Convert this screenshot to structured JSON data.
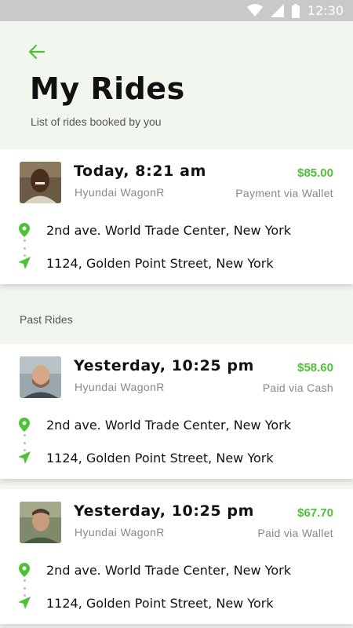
{
  "status_bar": {
    "time": "12:30"
  },
  "header": {
    "title": "My Rides",
    "subtitle": "List of rides booked by you"
  },
  "section_label": "Past Rides",
  "colors": {
    "accent": "#4dc236",
    "background": "#f1f6ee"
  },
  "rides": [
    {
      "time": "Today, 8:21 am",
      "car": "Hyundai  WagonR",
      "price": "$85.00",
      "payment": "Payment via Wallet",
      "pickup": "2nd ave. World Trade Center, New York",
      "drop": "1124, Golden Point Street, New York"
    },
    {
      "time": "Yesterday, 10:25 pm",
      "car": "Hyundai  WagonR",
      "price": "$58.60",
      "payment": "Paid via Cash",
      "pickup": "2nd ave. World Trade Center, New York",
      "drop": "1124, Golden Point Street, New York"
    },
    {
      "time": "Yesterday, 10:25 pm",
      "car": "Hyundai  WagonR",
      "price": "$67.70",
      "payment": "Paid via Wallet",
      "pickup": "2nd ave. World Trade Center, New York",
      "drop": "1124, Golden Point Street, New York"
    }
  ]
}
